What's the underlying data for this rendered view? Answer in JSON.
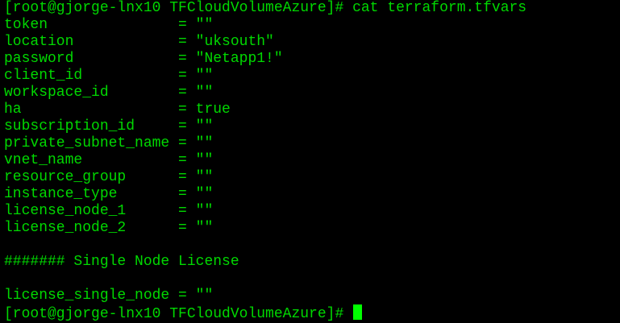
{
  "terminal": {
    "lines": [
      "[root@gjorge-lnx10 TFCloudVolumeAzure]# cat terraform.tfvars",
      "token               = \"\"",
      "location            = \"uksouth\"",
      "password            = \"Netapp1!\"",
      "client_id           = \"\"",
      "workspace_id        = \"\"",
      "ha                  = true",
      "subscription_id     = \"\"",
      "private_subnet_name = \"\"",
      "vnet_name           = \"\"",
      "resource_group      = \"\"",
      "instance_type       = \"\"",
      "license_node_1      = \"\"",
      "license_node_2      = \"\"",
      "",
      "####### Single Node License",
      "",
      "license_single_node = \"\""
    ],
    "prompt": "[root@gjorge-lnx10 TFCloudVolumeAzure]# "
  }
}
